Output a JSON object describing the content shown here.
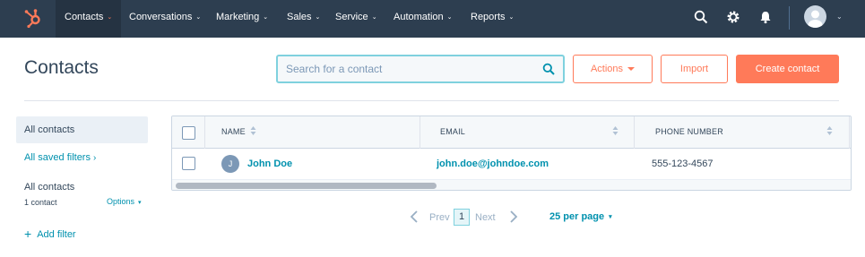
{
  "nav": {
    "items": [
      {
        "label": "Contacts"
      },
      {
        "label": "Conversations"
      },
      {
        "label": "Marketing"
      },
      {
        "label": "Sales"
      },
      {
        "label": "Service"
      },
      {
        "label": "Automation"
      },
      {
        "label": "Reports"
      }
    ],
    "chevron": "⌄"
  },
  "header": {
    "title": "Contacts",
    "search_placeholder": "Search for a contact",
    "actions_label": "Actions",
    "import_label": "Import",
    "create_label": "Create contact"
  },
  "sidebar": {
    "all_contacts": "All contacts",
    "saved_filters": "All saved filters",
    "saved_filters_arrow": "›",
    "view_name": "All contacts",
    "view_count": "1 contact",
    "options_label": "Options",
    "options_caret": "▾",
    "add_filter_plus": "+",
    "add_filter": "Add filter"
  },
  "table": {
    "columns": [
      "NAME",
      "EMAIL",
      "PHONE NUMBER"
    ],
    "rows": [
      {
        "initial": "J",
        "name": "John Doe",
        "email": "john.doe@johndoe.com",
        "phone": "555-123-4567"
      }
    ]
  },
  "pagination": {
    "prev": "Prev",
    "page": "1",
    "next": "Next",
    "per_page": "25 per page",
    "per_page_caret": "▾"
  },
  "colors": {
    "nav_bg": "#2d3e50",
    "accent": "#ff7a59",
    "link": "#0091ae",
    "text": "#33475b"
  }
}
